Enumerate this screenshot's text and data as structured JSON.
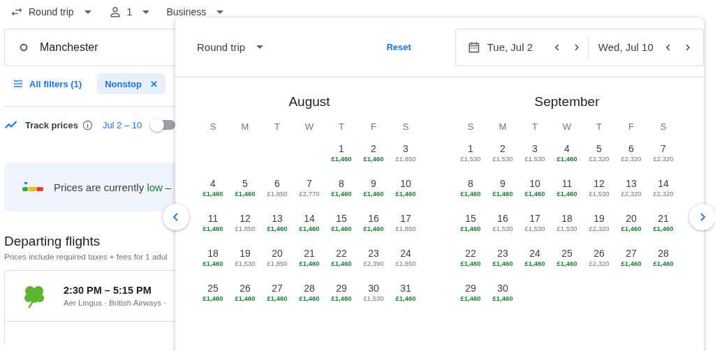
{
  "top_bar": {
    "trip_type": "Round trip",
    "passengers": "1",
    "cabin_class": "Business"
  },
  "origin": {
    "value": "Manchester"
  },
  "filters": {
    "all_filters": "All filters (1)",
    "chips": [
      {
        "label": "Nonstop",
        "selected": true
      }
    ]
  },
  "track_prices": {
    "label": "Track prices",
    "dates": "Jul 2 – 10",
    "on": false
  },
  "price_banner": {
    "text": "Prices are currently **low** –"
  },
  "departing": {
    "title": "Departing flights",
    "subtitle": "Prices include required taxes + fees for 1 adul",
    "flights": [
      {
        "times": "2:30 PM – 5:15 PM",
        "airlines": "Aer Lingus · British Airways ·"
      }
    ]
  },
  "dialog": {
    "trip_type": "Round trip",
    "reset": "Reset",
    "departure_date": "Tue, Jul 2",
    "return_date": "Wed, Jul 10",
    "months": [
      {
        "name": "August",
        "weekdays": [
          "S",
          "M",
          "T",
          "W",
          "T",
          "F",
          "S"
        ],
        "weeks": [
          [
            {
              "d": "1",
              "p": "£1,460",
              "low": true
            },
            {
              "d": "2",
              "p": "£1,460",
              "low": true
            },
            {
              "d": "3",
              "p": "£1,850",
              "low": false
            }
          ],
          [
            {
              "d": "4",
              "p": "£1,460",
              "low": true
            },
            {
              "d": "5",
              "p": "£1,460",
              "low": true
            },
            {
              "d": "6",
              "p": "£1,850",
              "low": false
            },
            {
              "d": "7",
              "p": "£2,770",
              "low": false
            },
            {
              "d": "8",
              "p": "£1,460",
              "low": true
            },
            {
              "d": "9",
              "p": "£1,460",
              "low": true
            },
            {
              "d": "10",
              "p": "£1,460",
              "low": true
            }
          ],
          [
            {
              "d": "11",
              "p": "£1,460",
              "low": true
            },
            {
              "d": "12",
              "p": "£1,850",
              "low": false
            },
            {
              "d": "13",
              "p": "£1,460",
              "low": true
            },
            {
              "d": "14",
              "p": "£1,460",
              "low": true
            },
            {
              "d": "15",
              "p": "£1,460",
              "low": true
            },
            {
              "d": "16",
              "p": "£1,460",
              "low": true
            },
            {
              "d": "17",
              "p": "£1,850",
              "low": false
            }
          ],
          [
            {
              "d": "18",
              "p": "£1,460",
              "low": true
            },
            {
              "d": "19",
              "p": "£1,530",
              "low": false
            },
            {
              "d": "20",
              "p": "£1,850",
              "low": false
            },
            {
              "d": "21",
              "p": "£1,460",
              "low": true
            },
            {
              "d": "22",
              "p": "£1,460",
              "low": true
            },
            {
              "d": "23",
              "p": "£2,390",
              "low": false
            },
            {
              "d": "24",
              "p": "£1,850",
              "low": false
            }
          ],
          [
            {
              "d": "25",
              "p": "£1,460",
              "low": true
            },
            {
              "d": "26",
              "p": "£1,460",
              "low": true
            },
            {
              "d": "27",
              "p": "£1,460",
              "low": true
            },
            {
              "d": "28",
              "p": "£1,460",
              "low": true
            },
            {
              "d": "29",
              "p": "£1,460",
              "low": true
            },
            {
              "d": "30",
              "p": "£1,530",
              "low": false
            },
            {
              "d": "31",
              "p": "£1,460",
              "low": true
            }
          ]
        ]
      },
      {
        "name": "September",
        "weekdays": [
          "S",
          "M",
          "T",
          "W",
          "T",
          "F",
          "S"
        ],
        "weeks": [
          [
            {
              "d": "1",
              "p": "£1,530",
              "low": false
            },
            {
              "d": "2",
              "p": "£1,530",
              "low": false
            },
            {
              "d": "3",
              "p": "£1,530",
              "low": false
            },
            {
              "d": "4",
              "p": "£1,460",
              "low": true
            },
            {
              "d": "5",
              "p": "£2,320",
              "low": false
            },
            {
              "d": "6",
              "p": "£2,320",
              "low": false
            },
            {
              "d": "7",
              "p": "£2,320",
              "low": false
            }
          ],
          [
            {
              "d": "8",
              "p": "£1,460",
              "low": true
            },
            {
              "d": "9",
              "p": "£1,460",
              "low": true
            },
            {
              "d": "10",
              "p": "£1,460",
              "low": true
            },
            {
              "d": "11",
              "p": "£1,460",
              "low": true
            },
            {
              "d": "12",
              "p": "£1,530",
              "low": false
            },
            {
              "d": "13",
              "p": "£2,320",
              "low": false
            },
            {
              "d": "14",
              "p": "£2,320",
              "low": false
            }
          ],
          [
            {
              "d": "15",
              "p": "£1,460",
              "low": true
            },
            {
              "d": "16",
              "p": "£1,530",
              "low": false
            },
            {
              "d": "17",
              "p": "£1,530",
              "low": false
            },
            {
              "d": "18",
              "p": "£1,530",
              "low": false
            },
            {
              "d": "19",
              "p": "£2,320",
              "low": false
            },
            {
              "d": "20",
              "p": "£1,460",
              "low": true
            },
            {
              "d": "21",
              "p": "£1,460",
              "low": true
            }
          ],
          [
            {
              "d": "22",
              "p": "£1,460",
              "low": true
            },
            {
              "d": "23",
              "p": "£1,460",
              "low": true
            },
            {
              "d": "24",
              "p": "£1,460",
              "low": true
            },
            {
              "d": "25",
              "p": "£1,460",
              "low": true
            },
            {
              "d": "26",
              "p": "£2,320",
              "low": false
            },
            {
              "d": "27",
              "p": "£1,460",
              "low": true
            },
            {
              "d": "28",
              "p": "£1,460",
              "low": true
            }
          ],
          [
            {
              "d": "29",
              "p": "£1,460",
              "low": true
            },
            {
              "d": "30",
              "p": "£1,460",
              "low": true
            }
          ]
        ]
      }
    ]
  }
}
